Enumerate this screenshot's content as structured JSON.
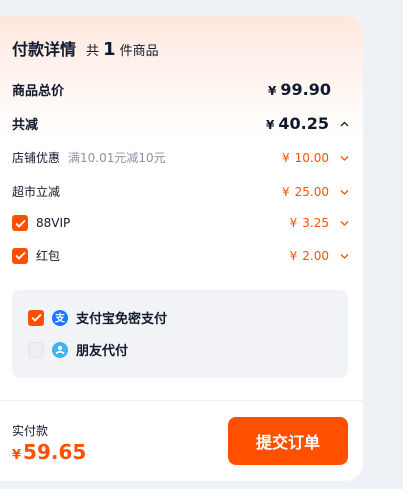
{
  "header": {
    "title": "付款详情",
    "count_prefix": "共",
    "count": "1",
    "count_suffix": "件商品"
  },
  "summary": {
    "subtotal_label": "商品总价",
    "subtotal_currency": "¥",
    "subtotal_value": "99.90",
    "discount_label": "共减",
    "discount_currency": "¥",
    "discount_value": "40.25"
  },
  "discounts": [
    {
      "label": "店铺优惠",
      "note": "满10.01元减10元",
      "currency": "¥",
      "value": "10.00",
      "checked": null
    },
    {
      "label": "超市立减",
      "note": "",
      "currency": "¥",
      "value": "25.00",
      "checked": null
    },
    {
      "label": "88VIP",
      "note": "",
      "currency": "¥",
      "value": "3.25",
      "checked": true
    },
    {
      "label": "红包",
      "note": "",
      "currency": "¥",
      "value": "2.00",
      "checked": true
    }
  ],
  "payment": {
    "options": [
      {
        "label": "支付宝免密支付",
        "checked": true,
        "icon": "alipay-icon"
      },
      {
        "label": "朋友代付",
        "checked": false,
        "icon": "friend-pay-icon"
      }
    ]
  },
  "footer": {
    "total_label": "实付款",
    "total_currency": "¥",
    "total_value": "59.65",
    "submit_label": "提交订单"
  },
  "colors": {
    "accent": "#ff5000",
    "alipay": "#1677ff",
    "friend_pay": "#3fb3f0"
  }
}
